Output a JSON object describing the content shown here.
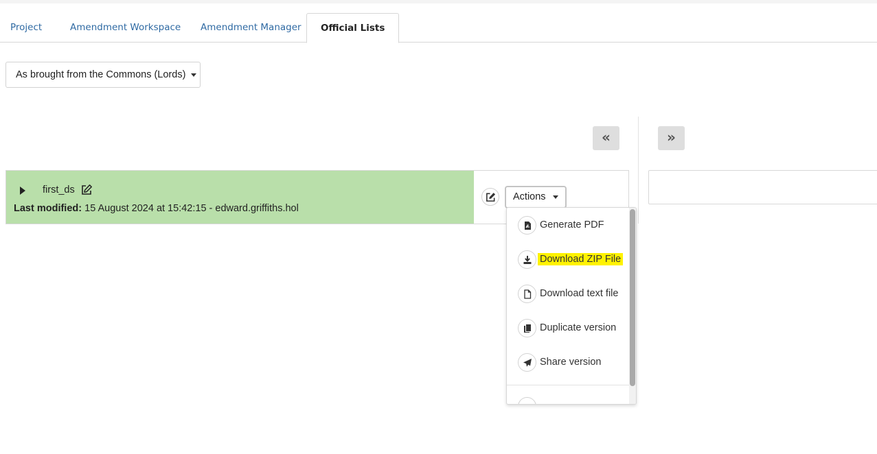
{
  "tabs": [
    {
      "label": "Project",
      "active": false
    },
    {
      "label": "Amendment Workspace",
      "active": false
    },
    {
      "label": "Amendment Manager",
      "active": false
    },
    {
      "label": "Official Lists",
      "active": true
    }
  ],
  "stage_select": {
    "value": "As brought from the Commons (Lords)"
  },
  "nav": {
    "prev_label": "«",
    "next_label": "»"
  },
  "version": {
    "name": "first_ds",
    "last_modified_label": "Last modified:",
    "last_modified_value": "15 August 2024 at 15:42:15 - edward.griffiths.hol",
    "background_color": "#b9dfaa"
  },
  "actions": {
    "label": "Actions",
    "menu_items": [
      {
        "label": "Generate PDF",
        "icon": "file-pdf-icon"
      },
      {
        "label": "Download ZIP File",
        "icon": "download-icon",
        "highlighted": true,
        "highlight_color": "#fff200"
      },
      {
        "label": "Download text file",
        "icon": "file-icon"
      },
      {
        "label": "Duplicate version",
        "icon": "copy-icon"
      },
      {
        "label": "Share version",
        "icon": "paper-plane-icon"
      }
    ]
  }
}
